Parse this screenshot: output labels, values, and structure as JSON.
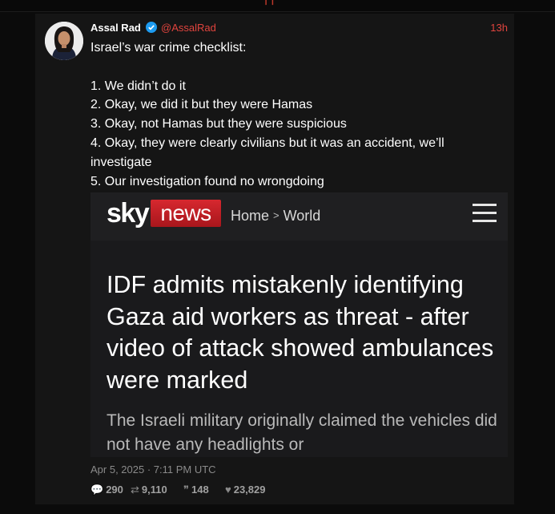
{
  "tweet": {
    "display_name": "Assal Rad",
    "handle": "@AssalRad",
    "time_ago": "13h",
    "text_lines": [
      "Israel’s war crime checklist:",
      "",
      "1. We didn’t do it",
      "2. Okay, we did it but they were Hamas",
      "3. Okay, not Hamas but they were suspicious",
      "4. Okay, they were clearly civilians but it was an accident, we’ll investigate",
      "5. Our investigation found no wrongdoing"
    ],
    "date": "Apr 5, 2025 · 7:11 PM UTC",
    "stats": {
      "replies": "290",
      "retweets": "9,110",
      "quotes": "148",
      "likes": "23,829"
    }
  },
  "embed": {
    "logo_sky": "sky",
    "logo_news": "news",
    "breadcrumb_home": "Home",
    "breadcrumb_sep": ">",
    "breadcrumb_section": "World",
    "headline": "IDF admits mistakenly identifying Gaza aid workers as threat - after video of attack showed ambulances were marked",
    "lede": "The Israeli military originally claimed the vehicles did not have any headlights or"
  },
  "icons": {
    "verified": "verified-badge-icon",
    "reply": "speech-bubble-icon",
    "retweet": "retweet-icon",
    "quote": "quote-icon",
    "like": "heart-icon",
    "menu": "hamburger-menu-icon"
  },
  "colors": {
    "accent": "#e0443e",
    "verified": "#1d9bf0",
    "sky_red": "#d7282f"
  }
}
